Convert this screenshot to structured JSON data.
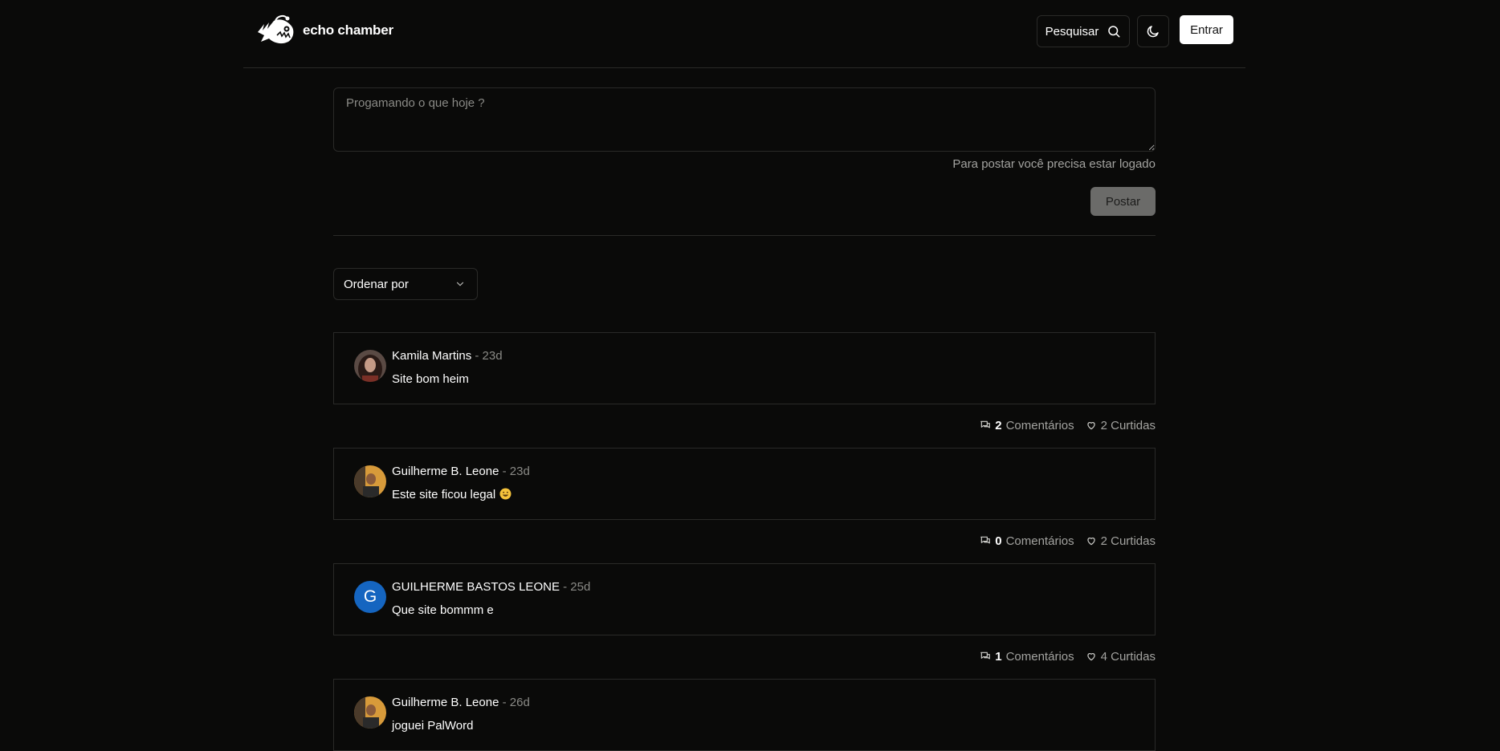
{
  "header": {
    "logo_text": "echo chamber",
    "search_label": "Pesquisar",
    "login_label": "Entrar"
  },
  "composer": {
    "placeholder": "Progamando o que hoje ?",
    "login_hint": "Para postar você precisa estar logado",
    "post_label": "Postar"
  },
  "sort": {
    "label": "Ordenar por"
  },
  "posts": [
    {
      "author": "Kamila Martins",
      "separator": " - ",
      "time": "23d",
      "text": "Site bom heim",
      "comments_count": "2",
      "comments_label": "Comentários",
      "likes": "2 Curtidas"
    },
    {
      "author": "Guilherme B. Leone",
      "separator": " - ",
      "time": "23d",
      "text": "Este site ficou legal",
      "comments_count": "0",
      "comments_label": "Comentários",
      "likes": "2 Curtidas"
    },
    {
      "author": "GUILHERME BASTOS LEONE",
      "avatar_letter": "G",
      "separator": " - ",
      "time": "25d",
      "text": "Que site bommm e",
      "comments_count": "1",
      "comments_label": "Comentários",
      "likes": "4 Curtidas"
    },
    {
      "author": "Guilherme B. Leone",
      "separator": " - ",
      "time": "26d",
      "text": "joguei PalWord"
    }
  ],
  "colors": {
    "background": "#0a0a09",
    "border": "#2a2a28",
    "letter_avatar": "#1565c0"
  }
}
